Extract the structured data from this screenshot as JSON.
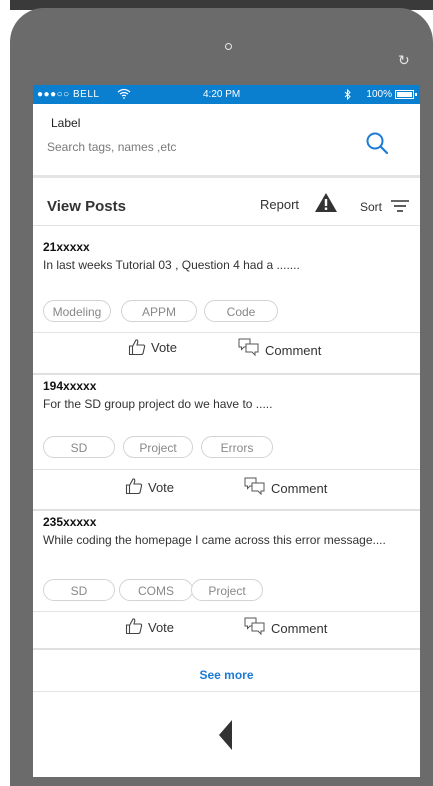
{
  "status_bar": {
    "carrier": "●●●○○ BELL",
    "time": "4:20 PM",
    "battery": "100%"
  },
  "search": {
    "label": "Label",
    "placeholder": "Search tags, names ,etc"
  },
  "header": {
    "title": "View Posts",
    "report_label": "Report",
    "sort_label": "Sort"
  },
  "posts": [
    {
      "id": "21xxxxx",
      "text": "In last weeks Tutorial 03 , Question 4 had a .......",
      "tags": [
        "Modeling",
        "APPM",
        "Code"
      ],
      "vote_label": "Vote",
      "comment_label": "Comment"
    },
    {
      "id": "194xxxxx",
      "text": "For the SD group project do we have to .....",
      "tags": [
        "SD",
        "Project",
        "Errors"
      ],
      "vote_label": "Vote",
      "comment_label": "Comment"
    },
    {
      "id": "235xxxxx",
      "text": "While coding the homepage I came across this error message....",
      "tags": [
        "SD",
        "COMS",
        "Project"
      ],
      "vote_label": "Vote",
      "comment_label": "Comment"
    }
  ],
  "footer": {
    "see_more": "See more"
  },
  "colors": {
    "status_bar": "#0a7fd0",
    "accent": "#1c7bd4",
    "phone_shell": "#6b6b6b"
  },
  "icons": [
    "wifi-icon",
    "bluetooth-icon",
    "battery-icon",
    "search-icon",
    "warning-icon",
    "sort-icon",
    "thumbs-up-icon",
    "comment-icon",
    "back-arrow-icon",
    "rotate-icon"
  ]
}
